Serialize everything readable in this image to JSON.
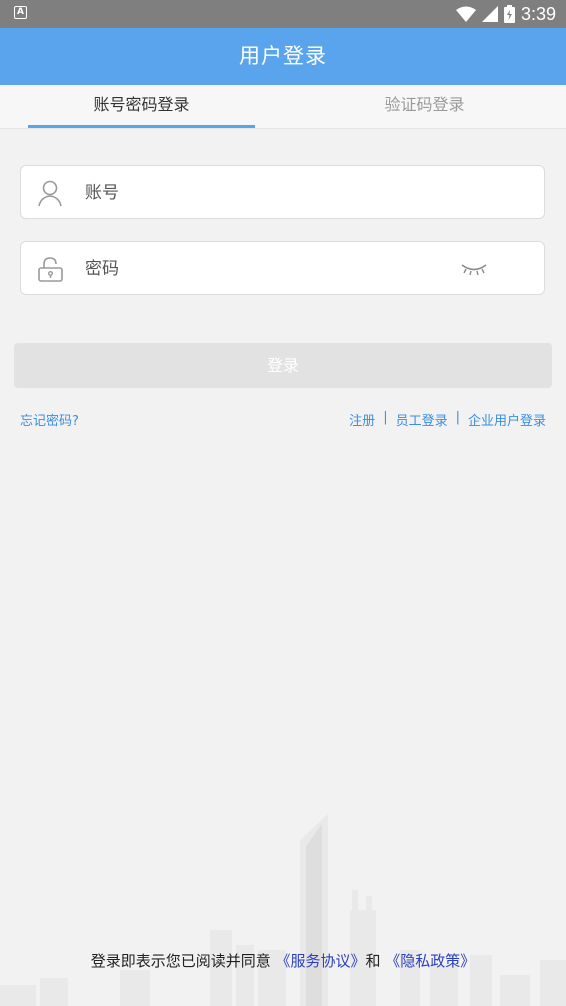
{
  "status_bar": {
    "time": "3:39",
    "notification_letter": "A"
  },
  "header": {
    "title": "用户登录"
  },
  "tabs": [
    {
      "label": "账号密码登录",
      "active": true
    },
    {
      "label": "验证码登录",
      "active": false
    }
  ],
  "form": {
    "account_placeholder": "账号",
    "password_placeholder": "密码",
    "login_label": "登录"
  },
  "links": {
    "forgot": "忘记密码?",
    "register": "注册",
    "separator": "|",
    "staff_login": "员工登录",
    "enterprise_login": "企业用户登录"
  },
  "agreement": {
    "prefix": "登录即表示您已阅读并同意",
    "service": "《服务协议》",
    "and": "和",
    "privacy": "《隐私政策》"
  },
  "colors": {
    "accent": "#5aa4ee",
    "link": "#3a8ee0",
    "agreement_link": "#2a3fbf",
    "button_disabled": "#e2e2e2"
  },
  "icons": [
    "wifi-icon",
    "signal-icon",
    "battery-icon",
    "user-icon",
    "lock-icon",
    "eye-closed-icon"
  ]
}
